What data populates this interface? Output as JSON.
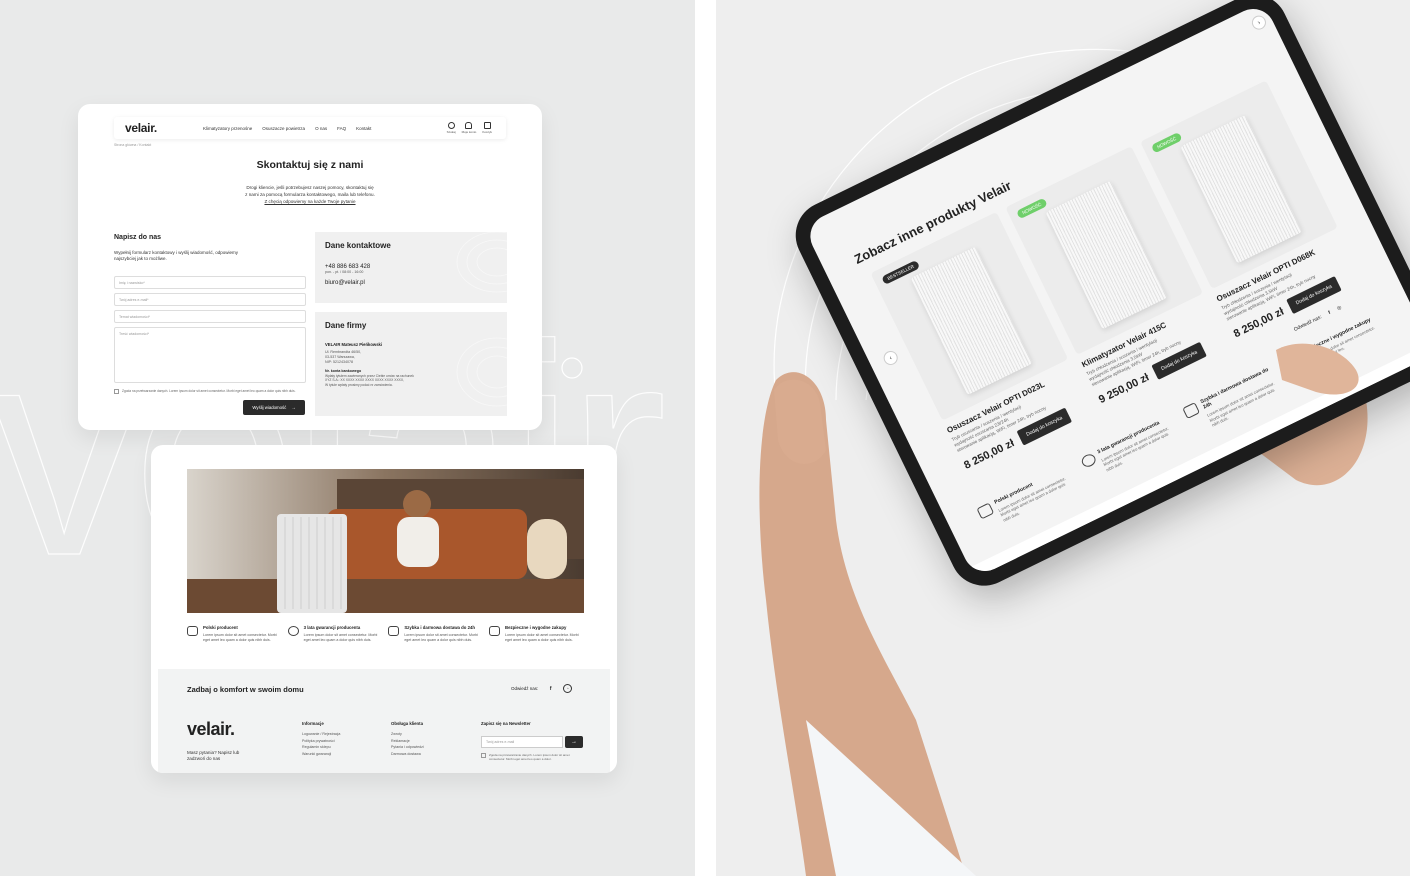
{
  "contact_page": {
    "logo": "velair.",
    "nav": [
      "Klimatyzatory przenośne",
      "Osuszacze powietrza",
      "O nas",
      "FAQ",
      "Kontakt"
    ],
    "nav_icons": [
      {
        "icon": "search-icon",
        "label": "Szukaj"
      },
      {
        "icon": "user-icon",
        "label": "Moje konto"
      },
      {
        "icon": "bag-icon",
        "label": "Koszyk"
      }
    ],
    "breadcrumb": "Strona główna / Kontakt",
    "title": "Skontaktuj się z nami",
    "intro_line1": "Drogi kliencie, jeśli potrzebujesz naszej pomocy, skontaktuj się",
    "intro_line2": "z nami za pomocą formularza kontaktowego, maila lub telefonu.",
    "intro_link": "Z chęcią odpowiemy na każde Twoje pytanie",
    "form": {
      "title": "Napisz do nas",
      "description": "Wypełnij formularz kontaktowy i wyślij wiadomość, odpowiemy najszybciej jak to możliwe.",
      "name_placeholder": "Imię i nazwisko*",
      "email_placeholder": "Twój adres e-mail*",
      "subject_placeholder": "Temat wiadomości*",
      "message_placeholder": "Treść wiadomości*",
      "consent": "Zgoda na przetwarzanie danych. Lorem ipsum dolor sit amet consectetur. Morbi eget amet leo quam a dolor quis nibh duis.",
      "submit": "Wyślij wiadomość"
    },
    "contact_box": {
      "title": "Dane kontaktowe",
      "phone": "+48 886 683 428",
      "hours": "pon. - pt. / 08:00 - 16:00",
      "email": "biuro@velair.pl"
    },
    "company_box": {
      "title": "Dane firmy",
      "name": "VELAIR Mateusz Pieńkowski",
      "address1": "Ul. Rembrandta 46/50,",
      "address2": "03-537 Warszawa,",
      "nip": "NIP: 5212434078",
      "bank_label": "Nr. konta bankowego",
      "bank_text1": "Wpłaty tytułem zawieranych przez Ciebie umów na rachunek",
      "bank_text2": "XYZ S.A.: XX XXXX XXXX XXXX XXXX XXXX XXXX,",
      "bank_text3": "W tytule wpłaty prosimy podać nr zamówienia."
    }
  },
  "home_page": {
    "features": [
      {
        "icon": "poland-map-icon",
        "title": "Polski producent",
        "desc": "Lorem ipsum dolor sit amet consectetur. Morbi eget amet leo quam a dolor quis nibh duis."
      },
      {
        "icon": "warranty-badge-icon",
        "title": "3 lata gwarancji producenta",
        "desc": "Lorem ipsum dolor sit amet consectetur. Morbi eget amet leo quam a dolor quis nibh duis."
      },
      {
        "icon": "delivery-truck-icon",
        "title": "Szybka i darmowa dostawa do 24h",
        "desc": "Lorem ipsum dolor sit amet consectetur. Morbi eget amet leo quam a dolor quis nibh duis."
      },
      {
        "icon": "credit-card-icon",
        "title": "Bezpieczne i wygodne zakupy",
        "desc": "Lorem ipsum dolor sit amet consectetur. Morbi eget amet leo quam a dolor quis nibh duis."
      }
    ],
    "footer": {
      "tagline": "Zadbaj o komfort w swoim domu",
      "visit": "Odwiedź nas:",
      "logo": "velair.",
      "ask": "Masz pytania? Napisz lub zadzwoń do nas",
      "col1_title": "Informacje",
      "col1": [
        "Logowanie / Rejestracja",
        "Polityka prywatności",
        "Regulamin sklepu",
        "Warunki gwarancji"
      ],
      "col2_title": "Obsługa klienta",
      "col2": [
        "Zwroty",
        "Reklamacje",
        "Pytania i odpowiedzi",
        "Darmowa dostawa"
      ],
      "newsletter_title": "Zapisz się na Newsletter",
      "newsletter_placeholder": "Twój adres e-mail",
      "newsletter_consent": "Zgoda na przetwarzanie danych. Lorem ipsum dolor sit amet consectetur. Morbi eget amet leo quam a dolor."
    }
  },
  "tablet": {
    "title": "Zobacz inne produkty Velair",
    "products": [
      {
        "tag": "BESTSELLER",
        "tag_color": "#2b2b2b",
        "name": "Osuszacz Velair OPTI D023L",
        "bullets": [
          "Tryb osuszania / suszenia / wentylacji",
          "wydajność osuszania 23l/24h",
          "sterowanie aplikacją, WiFi, timer 24h, tryb nocny"
        ],
        "price": "8 250,00 zł",
        "button": "Dodaj do koszyka"
      },
      {
        "tag": "NOWOŚĆ",
        "tag_color": "#6fcf6a",
        "name": "Klimatyzator Velair 415C",
        "bullets": [
          "Tryb chłodzenia / suszenia / wentylacji",
          "wydajność chłodzenia 3,5kW",
          "sterowanie aplikacją, WiFi, timer 24h, tryb nocny"
        ],
        "price": "9 250,00 zł",
        "button": "Dodaj do koszyka"
      },
      {
        "tag": "NOWOŚĆ",
        "tag_color": "#6fcf6a",
        "name": "Osuszacz Velair OPTI D068K",
        "bullets": [
          "Tryb chłodzenia / suszenia / wentylacji",
          "wydajność chłodzenia 3,5kW",
          "sterowanie aplikacją, WiFi, timer 24h, tryb nocny"
        ],
        "price": "8 250,00 zł",
        "button": "Dodaj do koszyka"
      }
    ],
    "features": [
      {
        "title": "Polski producent",
        "desc": "Lorem ipsum dolor sit amet consectetur. Morbi eget amet leo quam a dolor quis nibh duis."
      },
      {
        "title": "3 lata gwarancji producenta",
        "desc": "Lorem ipsum dolor sit amet consectetur. Morbi eget amet leo quam a dolor quis nibh duis."
      },
      {
        "title": "Szybka i darmowa dostawa do 24h",
        "desc": "Lorem ipsum dolor sit amet consectetur. Morbi eget amet leo quam a dolor quis nibh duis."
      },
      {
        "title": "Bezpieczne i wygodne zakupy",
        "desc": "Lorem ipsum dolor sit amet consectetur. Morbi eget amet leo."
      }
    ],
    "visit": "Odwiedź nas:",
    "bottom_title": "Zadbaj o komfort w swoim domu"
  },
  "watermark": "velair"
}
